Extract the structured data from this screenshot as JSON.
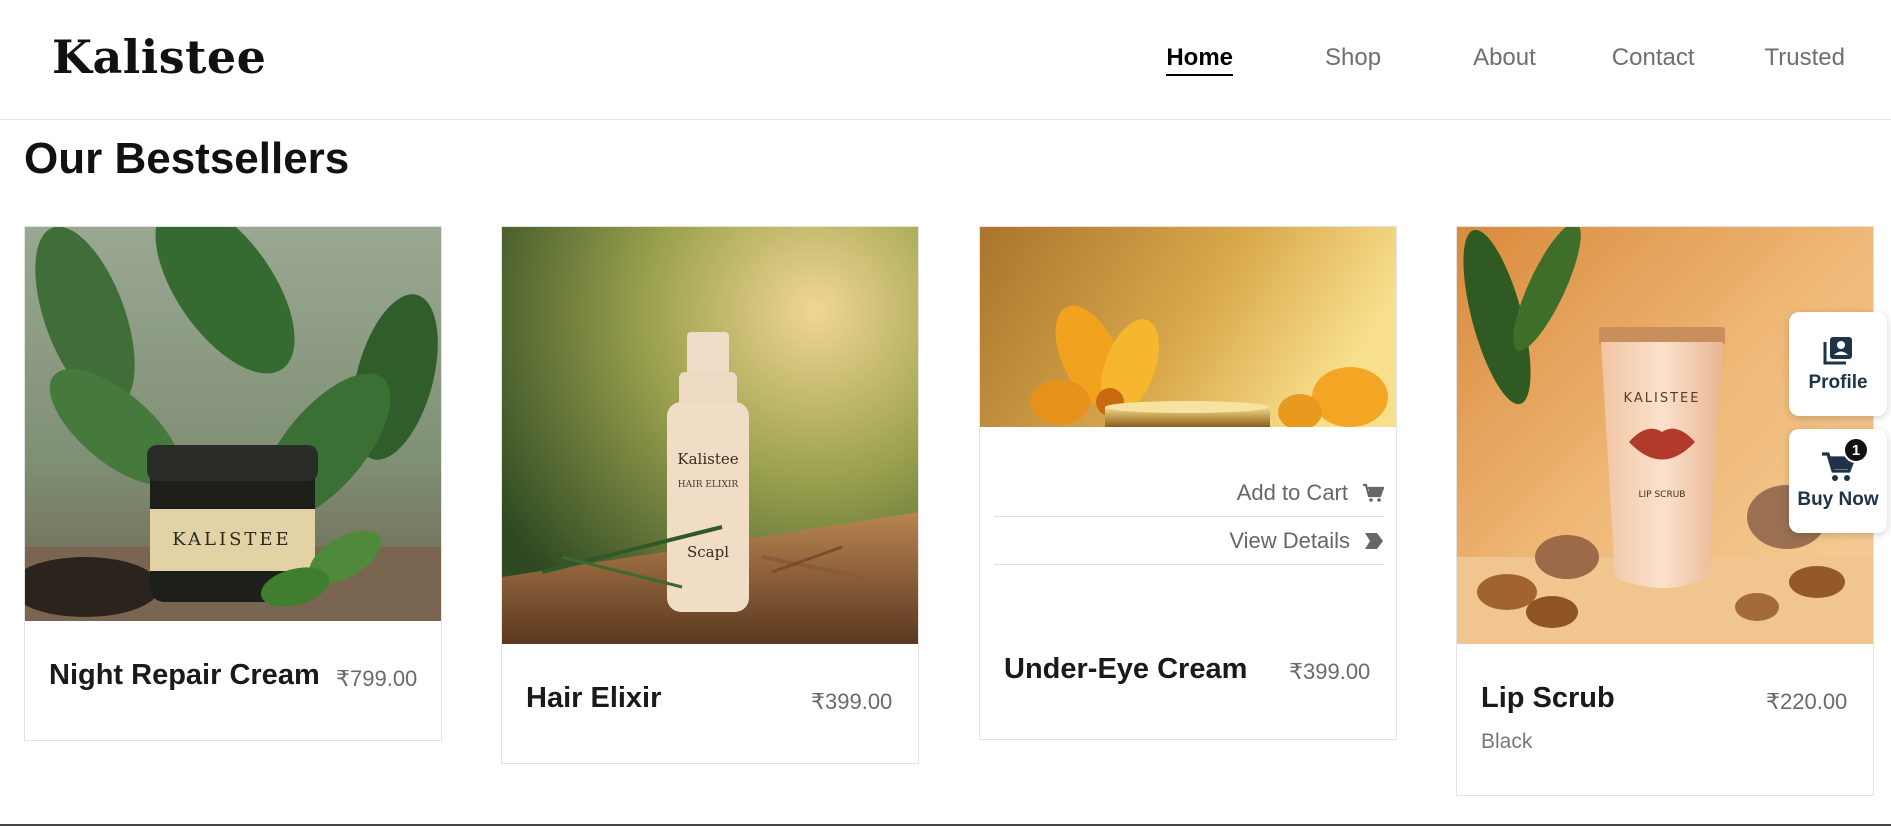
{
  "brand": {
    "name": "Kalistee"
  },
  "nav": {
    "items": [
      "Home",
      "Shop",
      "About",
      "Contact",
      "Trusted"
    ],
    "active": "Home"
  },
  "section": {
    "title": "Our Bestsellers"
  },
  "products": [
    {
      "name": "Night Repair Cream",
      "price": "₹799.00",
      "image_icon": "cream-jar-image",
      "jar_label": "KALISTEE"
    },
    {
      "name": "Hair Elixir",
      "price": "₹399.00",
      "image_icon": "serum-bottle-image",
      "bottle_label": "Kalistee",
      "bottle_sub": "HAIR ELIXIR",
      "bottle_foot": "Scapl"
    },
    {
      "name": "Under-Eye Cream",
      "price": "₹399.00",
      "image_icon": "eye-cream-image",
      "actions": {
        "add_to_cart": "Add to Cart",
        "view_details": "View Details"
      }
    },
    {
      "name": "Lip Scrub",
      "price": "₹220.00",
      "variant": "Black",
      "image_icon": "lip-scrub-tube-image",
      "tube_label": "KALISTEE",
      "tube_sub": "LIP SCRUB"
    }
  ],
  "floating": {
    "profile": {
      "label": "Profile",
      "icon": "profile-icon"
    },
    "buy_now": {
      "label": "Buy Now",
      "icon": "cart-icon",
      "count": "1"
    }
  },
  "colors": {
    "accent": "#1e3347",
    "text": "#111111",
    "muted": "#6a6a6a"
  }
}
